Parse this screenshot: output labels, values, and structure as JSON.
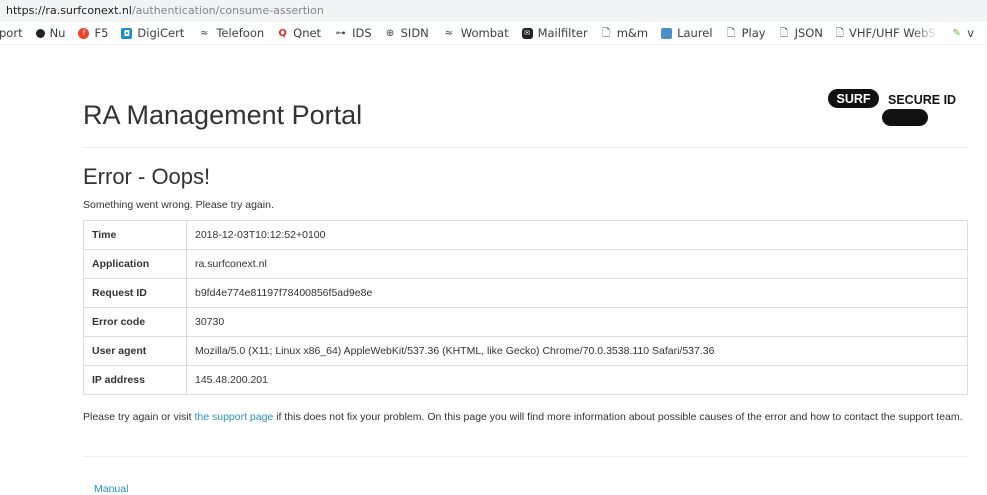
{
  "browser": {
    "url_host": "https://ra.surfconext.nl",
    "url_path": "/authentication/consume-assertion",
    "bookmarks": [
      {
        "label": "port",
        "icon": "none"
      },
      {
        "label": "Nu",
        "icon": "nu-icon"
      },
      {
        "label": "F5",
        "icon": "f5-icon"
      },
      {
        "label": "DigiCert",
        "icon": "digicert-icon"
      },
      {
        "label": "Telefoon",
        "icon": "wave-icon"
      },
      {
        "label": "Qnet",
        "icon": "qnet-icon"
      },
      {
        "label": "IDS",
        "icon": "ids-icon"
      },
      {
        "label": "SIDN",
        "icon": "sidn-icon"
      },
      {
        "label": "Wombat",
        "icon": "wave-icon"
      },
      {
        "label": "Mailfilter",
        "icon": "mailfilter-icon"
      },
      {
        "label": "m&m",
        "icon": "page-icon"
      },
      {
        "label": "Laurel",
        "icon": "laurel-icon"
      },
      {
        "label": "Play",
        "icon": "page-icon"
      },
      {
        "label": "JSON",
        "icon": "page-icon"
      },
      {
        "label": "VHF/UHF WebSDR",
        "icon": "page-icon"
      },
      {
        "label": "v",
        "icon": "v-icon"
      }
    ]
  },
  "header": {
    "title": "RA Management Portal",
    "logo_word1": "SURF",
    "logo_word2": "SECURE ID"
  },
  "error": {
    "title": "Error - Oops!",
    "subtitle": "Something went wrong. Please try again.",
    "rows": [
      {
        "key": "Time",
        "value": "2018-12-03T10:12:52+0100"
      },
      {
        "key": "Application",
        "value": "ra.surfconext.nl"
      },
      {
        "key": "Request ID",
        "value": "b9fd4e774e81197f78400856f5ad9e8e"
      },
      {
        "key": "Error code",
        "value": "30730"
      },
      {
        "key": "User agent",
        "value": "Mozilla/5.0 (X11; Linux x86_64) AppleWebKit/537.36 (KHTML, like Gecko) Chrome/70.0.3538.110 Safari/537.36"
      },
      {
        "key": "IP address",
        "value": "145.48.200.201"
      }
    ]
  },
  "help": {
    "before": "Please try again or visit ",
    "link": "the support page",
    "after": " if this does not fix your problem. On this page you will find more information about possible causes of the error and how to contact the support team."
  },
  "footer": {
    "manual_label": "Manual"
  },
  "colors": {
    "link": "#2a8fbd",
    "text": "#333333",
    "border": "#dddddd",
    "logo_black": "#111111"
  }
}
